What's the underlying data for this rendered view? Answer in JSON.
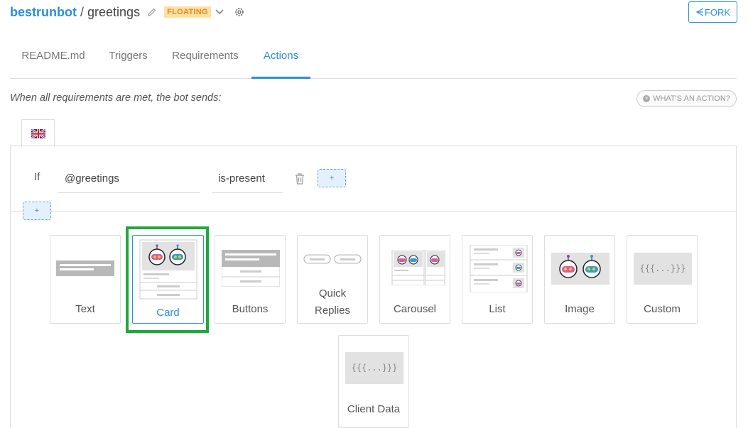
{
  "header": {
    "owner": "bestrunbot",
    "separator": "/",
    "bot_name": "greetings",
    "status_badge": "FLOATING",
    "fork_label": "FORK"
  },
  "tabs": [
    {
      "label": "README.md",
      "active": false
    },
    {
      "label": "Triggers",
      "active": false
    },
    {
      "label": "Requirements",
      "active": false
    },
    {
      "label": "Actions",
      "active": true
    }
  ],
  "subtitle": "When all requirements are met, the bot sends:",
  "whats_action_label": "WHAT'S AN ACTION?",
  "condition": {
    "if_label": "If",
    "variable": "@greetings",
    "operator": "is-present",
    "add_label": "+"
  },
  "add_action_label": "+",
  "message_types": [
    {
      "label": "Text",
      "selected": false
    },
    {
      "label": "Card",
      "selected": true
    },
    {
      "label": "Buttons",
      "selected": false
    },
    {
      "label": "Quick Replies",
      "selected": false
    },
    {
      "label": "Carousel",
      "selected": false
    },
    {
      "label": "List",
      "selected": false
    },
    {
      "label": "Image",
      "selected": false
    },
    {
      "label": "Custom",
      "selected": false
    },
    {
      "label": "Client Data",
      "selected": false
    }
  ],
  "custom_glyph": "{{{...}}}",
  "colors": {
    "accent": "#2a8fd8",
    "badge_bg": "#ffe1a6",
    "badge_text": "#e8881d",
    "selection_frame": "#1fa83d"
  }
}
